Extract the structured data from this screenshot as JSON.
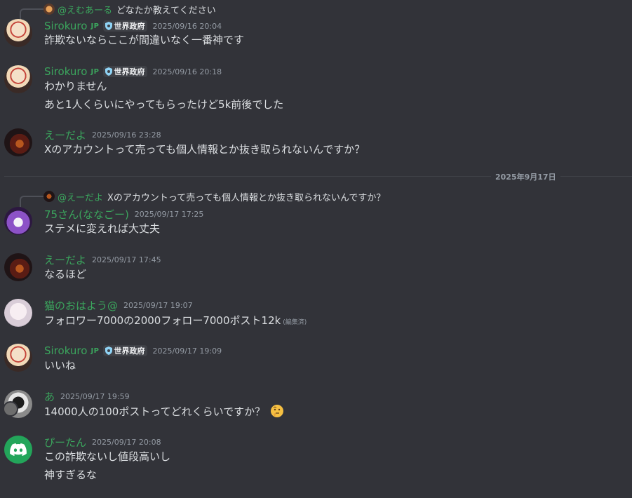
{
  "messages": {
    "m1": {
      "reply_name": "@えむあーる",
      "reply_text": "どなたか教えてください",
      "author": "Sirokuro",
      "region": "JP",
      "tag": "世界政府",
      "time": "2025/09/16 20:04",
      "lines": [
        "詐欺ないならここが間違いなく一番神です"
      ]
    },
    "m2": {
      "author": "Sirokuro",
      "region": "JP",
      "tag": "世界政府",
      "time": "2025/09/16 20:18",
      "lines": [
        "わかりません",
        "あと1人くらいにやってもらったけど5k前後でした"
      ]
    },
    "m3": {
      "author": "えーだよ",
      "time": "2025/09/16 23:28",
      "lines": [
        "Xのアカウントって売っても個人情報とか抜き取られないんですか？"
      ]
    },
    "divider": "2025年9月17日",
    "m4": {
      "reply_name": "@えーだよ",
      "reply_text": "Xのアカウントって売っても個人情報とか抜き取られないんですか？",
      "author": "75さん(ななごー)",
      "time": "2025/09/17 17:25",
      "lines": [
        "ステメに変えれば大丈夫"
      ]
    },
    "m5": {
      "author": "えーだよ",
      "time": "2025/09/17 17:45",
      "lines": [
        "なるほど"
      ]
    },
    "m6": {
      "author": "猫のおはよう@",
      "time": "2025/09/17 19:07",
      "lines": [
        "フォロワー7000の2000フォロー7000ポスト12k"
      ],
      "edited": "(編集済)"
    },
    "m7": {
      "author": "Sirokuro",
      "region": "JP",
      "tag": "世界政府",
      "time": "2025/09/17 19:09",
      "lines": [
        "いいね"
      ]
    },
    "m8": {
      "author": "あ",
      "time": "2025/09/17 19:59",
      "lines": [
        "14000人の100ポストってどれくらいですか？"
      ],
      "emoji": "thinking-face"
    },
    "m9": {
      "author": "ぴーたん",
      "time": "2025/09/17 20:08",
      "lines": [
        "この詐欺ないし値段高いし",
        "神すぎるな"
      ]
    }
  },
  "colors": {
    "background": "#323339",
    "username_green": "#3ba55d",
    "timestamp": "#949ba4",
    "text": "#dbdee1"
  }
}
